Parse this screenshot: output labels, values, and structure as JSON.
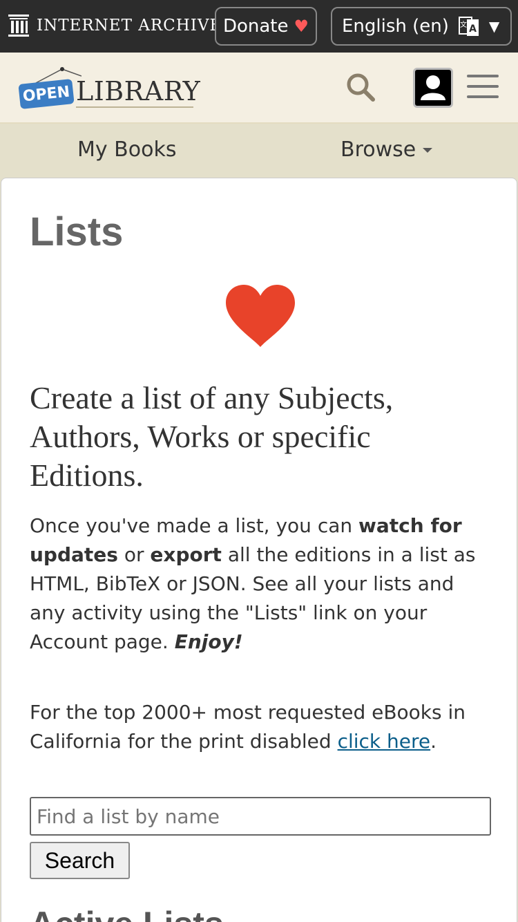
{
  "ia_bar": {
    "brand": "INTERNET ARCHIVE",
    "donate_label": "Donate",
    "donate_heart": "♥",
    "language_label": "English (en)",
    "language_caret": "▼"
  },
  "ol_header": {
    "logo_open": "OPEN",
    "logo_library": "LIBRARY"
  },
  "nav": {
    "my_books": "My Books",
    "browse": "Browse"
  },
  "main": {
    "title": "Lists",
    "headline": "Create a list of any Subjects, Authors, Works or specific Editions.",
    "para1": {
      "t1": "Once you've made a list, you can ",
      "b1": "watch for updates",
      "t2": " or ",
      "b2": "export",
      "t3": " all the editions in a list as HTML, BibTeX or JSON. See all your lists and any activity using the \"Lists\" link on your Account page. ",
      "enjoy": "Enjoy!"
    },
    "para2": {
      "text": "For the top 2000+ most requested eBooks in California for the print disabled ",
      "link": "click here",
      "end": "."
    },
    "search": {
      "placeholder": "Find a list by name",
      "button": "Search"
    },
    "active_lists_heading": "Active Lists"
  },
  "colors": {
    "ia_bar_bg": "#2c2c2c",
    "header_bg": "#f4efe2",
    "nav_bg": "#e4e0cb",
    "heart": "#e8432a",
    "link": "#0b5e8a",
    "logo_blue": "#3b7dc4"
  }
}
